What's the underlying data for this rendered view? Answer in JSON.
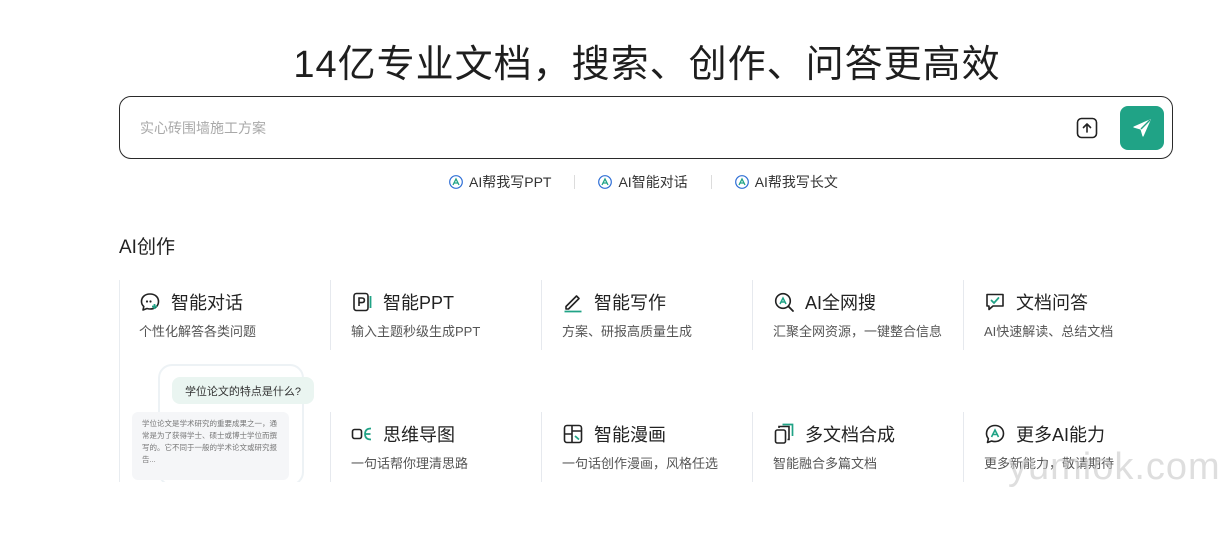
{
  "hero": {
    "title": "14亿专业文档，搜索、创作、问答更高效"
  },
  "search": {
    "placeholder": "实心砖围墙施工方案"
  },
  "quick_links": [
    {
      "label": "AI帮我写PPT"
    },
    {
      "label": "AI智能对话"
    },
    {
      "label": "AI帮我写长文"
    }
  ],
  "section": {
    "title": "AI创作"
  },
  "preview": {
    "question": "学位论文的特点是什么?",
    "answer": "学位论文是学术研究的重要成果之一，通常是为了获得学士、硕士或博士学位而撰写的。它不同于一般的学术论文或研究报告..."
  },
  "cards": [
    {
      "title": "智能对话",
      "desc": "个性化解答各类问题",
      "icon": "chat-icon"
    },
    {
      "title": "智能PPT",
      "desc": "输入主题秒级生成PPT",
      "icon": "ppt-icon"
    },
    {
      "title": "智能写作",
      "desc": "方案、研报高质量生成",
      "icon": "pen-icon"
    },
    {
      "title": "AI全网搜",
      "desc": "汇聚全网资源，一键整合信息",
      "icon": "search-ai-icon"
    },
    {
      "title": "文档问答",
      "desc": "AI快速解读、总结文档",
      "icon": "doc-chat-icon"
    },
    {
      "title": "思维导图",
      "desc": "一句话帮你理清思路",
      "icon": "mindmap-icon"
    },
    {
      "title": "智能漫画",
      "desc": "一句话创作漫画，风格任选",
      "icon": "comic-icon"
    },
    {
      "title": "多文档合成",
      "desc": "智能融合多篇文档",
      "icon": "multi-doc-icon"
    },
    {
      "title": "更多AI能力",
      "desc": "更多新能力，敬请期待",
      "icon": "more-ai-icon"
    }
  ],
  "watermark": "yumiok.com",
  "colors": {
    "accent": "#20a386",
    "text": "#222222",
    "muted": "#555555"
  }
}
